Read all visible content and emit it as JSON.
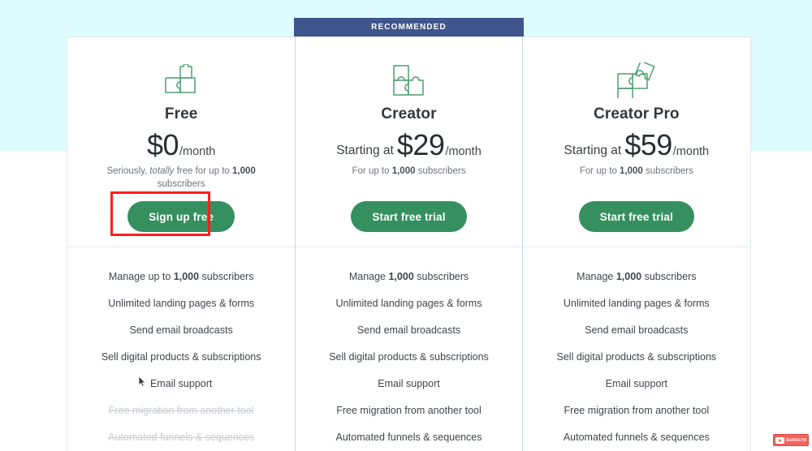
{
  "theme": {
    "band_color": "#defcfd",
    "ribbon_color": "#41558d",
    "cta_color": "#368f5f",
    "highlight_color": "#ff1d1d",
    "icon_color": "#4e9e72"
  },
  "ribbon": {
    "label": "RECOMMENDED"
  },
  "plans": [
    {
      "id": "free",
      "icon": "puzzle-two-pieces-icon",
      "name": "Free",
      "price_prefix": "",
      "price_amount": "$0",
      "price_period": "/month",
      "note_prefix": "Seriously, ",
      "note_italic": "totally",
      "note_mid": " free for up to ",
      "note_bold": "1,000",
      "note_suffix": " subscribers",
      "cta_label": "Sign up free",
      "highlighted": true,
      "features": [
        {
          "pre": "Manage up to ",
          "bold": "1,000",
          "post": " subscribers",
          "enabled": true
        },
        {
          "pre": "Unlimited landing pages & forms",
          "bold": "",
          "post": "",
          "enabled": true
        },
        {
          "pre": "Send email broadcasts",
          "bold": "",
          "post": "",
          "enabled": true
        },
        {
          "pre": "Sell digital products & subscriptions",
          "bold": "",
          "post": "",
          "enabled": true
        },
        {
          "pre": "Email support",
          "bold": "",
          "post": "",
          "enabled": true
        },
        {
          "pre": "Free migration from another tool",
          "bold": "",
          "post": "",
          "enabled": false
        },
        {
          "pre": "Automated funnels & sequences",
          "bold": "",
          "post": "",
          "enabled": false
        }
      ]
    },
    {
      "id": "creator",
      "icon": "puzzle-three-pieces-icon",
      "name": "Creator",
      "price_prefix": "Starting at",
      "price_amount": "$29",
      "price_period": "/month",
      "note_prefix": "For up to ",
      "note_italic": "",
      "note_mid": "",
      "note_bold": "1,000",
      "note_suffix": " subscribers",
      "cta_label": "Start free trial",
      "highlighted": false,
      "features": [
        {
          "pre": "Manage ",
          "bold": "1,000",
          "post": " subscribers",
          "enabled": true
        },
        {
          "pre": "Unlimited landing pages & forms",
          "bold": "",
          "post": "",
          "enabled": true
        },
        {
          "pre": "Send email broadcasts",
          "bold": "",
          "post": "",
          "enabled": true
        },
        {
          "pre": "Sell digital products & subscriptions",
          "bold": "",
          "post": "",
          "enabled": true
        },
        {
          "pre": "Email support",
          "bold": "",
          "post": "",
          "enabled": true
        },
        {
          "pre": "Free migration from another tool",
          "bold": "",
          "post": "",
          "enabled": true
        },
        {
          "pre": "Automated funnels & sequences",
          "bold": "",
          "post": "",
          "enabled": true
        }
      ]
    },
    {
      "id": "creator-pro",
      "icon": "puzzle-four-pieces-icon",
      "name": "Creator Pro",
      "price_prefix": "Starting at",
      "price_amount": "$59",
      "price_period": "/month",
      "note_prefix": "For up to ",
      "note_italic": "",
      "note_mid": "",
      "note_bold": "1,000",
      "note_suffix": " subscribers",
      "cta_label": "Start free trial",
      "highlighted": false,
      "features": [
        {
          "pre": "Manage ",
          "bold": "1,000",
          "post": " subscribers",
          "enabled": true
        },
        {
          "pre": "Unlimited landing pages & forms",
          "bold": "",
          "post": "",
          "enabled": true
        },
        {
          "pre": "Send email broadcasts",
          "bold": "",
          "post": "",
          "enabled": true
        },
        {
          "pre": "Sell digital products & subscriptions",
          "bold": "",
          "post": "",
          "enabled": true
        },
        {
          "pre": "Email support",
          "bold": "",
          "post": "",
          "enabled": true
        },
        {
          "pre": "Free migration from another tool",
          "bold": "",
          "post": "",
          "enabled": true
        },
        {
          "pre": "Automated funnels & sequences",
          "bold": "",
          "post": "",
          "enabled": true
        }
      ]
    }
  ],
  "overlay": {
    "subscribe_label": "Subscribe"
  }
}
